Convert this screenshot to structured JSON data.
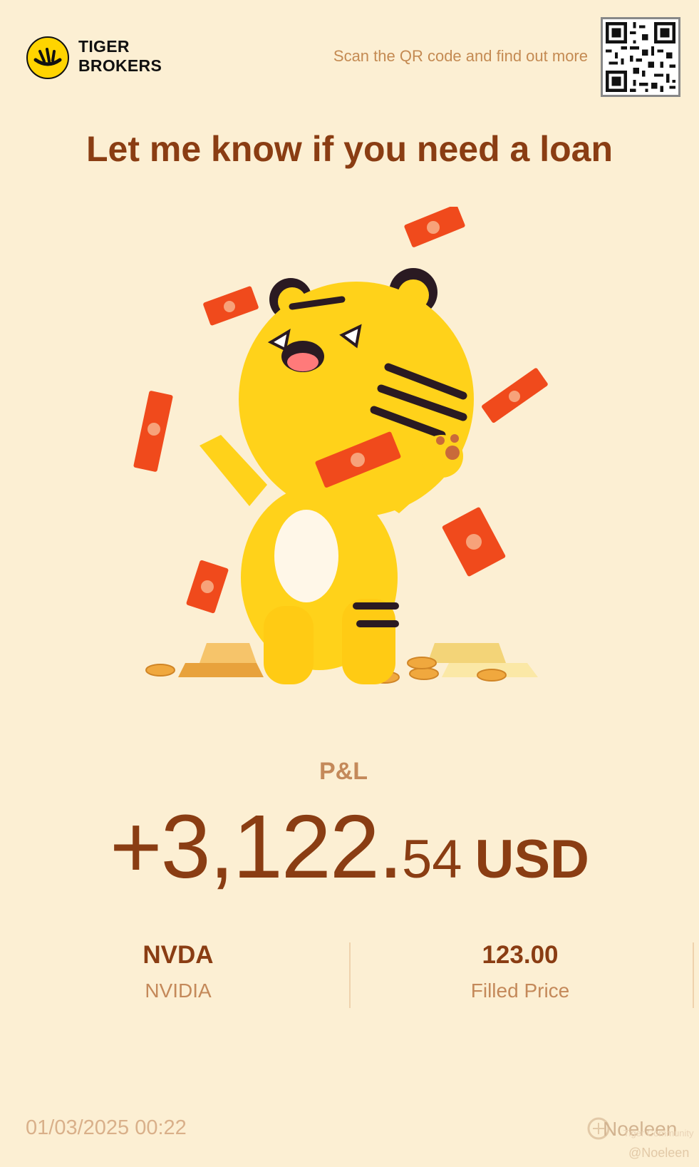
{
  "header": {
    "brand_line1": "TIGER",
    "brand_line2": "BROKERS",
    "scan_text": "Scan the QR code and find out more"
  },
  "headline": "Let me know if you need a loan",
  "pnl": {
    "label": "P&L",
    "sign_integer": "+3,122.",
    "decimal": "54",
    "currency": "USD"
  },
  "stock": {
    "ticker": "NVDA",
    "name": "NVIDIA"
  },
  "price": {
    "value": "123.00",
    "label": "Filled Price"
  },
  "footer": {
    "timestamp": "01/03/2025 00:22",
    "watermark_name": "Noeleen",
    "watermark_sub": "Tiger Community",
    "watermark_handle": "@Noeleen"
  },
  "colors": {
    "background": "#fcefd3",
    "primary_text": "#8a3d13",
    "secondary_text": "#c4895a",
    "logo_yellow": "#ffd400",
    "envelope_red": "#f04a1c"
  }
}
